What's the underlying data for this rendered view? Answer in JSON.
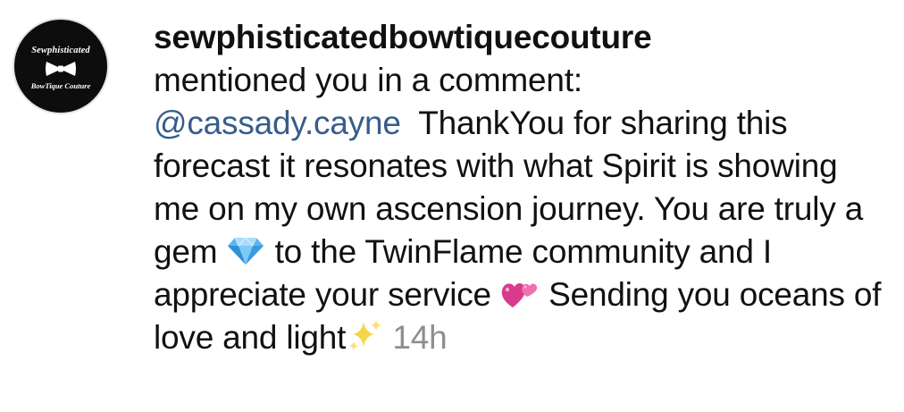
{
  "notification": {
    "avatar": {
      "logo_top": "Sewphisticated",
      "logo_bottom": "BowTique Couture",
      "icon": "bow-tie-icon"
    },
    "username": "sewphisticatedbowtiquecouture",
    "action": "mentioned you in a comment:",
    "mention": "@cassady.cayne",
    "comment_part1": "ThankYou for sharing this forecast it resonates with what Spirit is showing me on my own ascension journey. You are truly a gem",
    "emoji_gem": "gem-icon",
    "comment_part2": "to the TwinFlame community and I appreciate your service",
    "emoji_hearts": "two-hearts-icon",
    "comment_part3": "Sending you oceans of love and light",
    "emoji_sparkles": "sparkles-icon",
    "timestamp": "14h"
  }
}
